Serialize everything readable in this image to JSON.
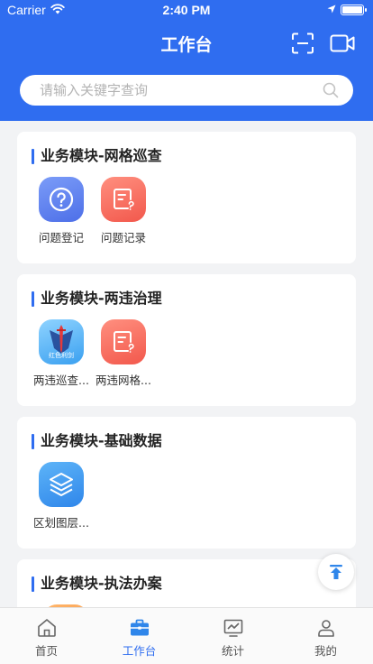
{
  "status_bar": {
    "carrier": "Carrier",
    "time": "2:40 PM"
  },
  "header": {
    "title": "工作台"
  },
  "search": {
    "placeholder": "请输入关键字查询"
  },
  "cards": [
    {
      "title": "业务模块-网格巡查",
      "apps": [
        {
          "label": "问题登记",
          "icon": "question-icon"
        },
        {
          "label": "问题记录",
          "icon": "record-icon"
        }
      ]
    },
    {
      "title": "业务模块-两违治理",
      "apps": [
        {
          "label": "两违巡查...",
          "icon": "sword-logo-icon",
          "logo_text": "红色利剑"
        },
        {
          "label": "两违网格...",
          "icon": "record-icon"
        }
      ]
    },
    {
      "title": "业务模块-基础数据",
      "apps": [
        {
          "label": "区划图层...",
          "icon": "layers-icon"
        }
      ]
    },
    {
      "title": "业务模块-执法办案",
      "apps": []
    }
  ],
  "tabbar": {
    "items": [
      {
        "label": "首页",
        "icon": "home-icon",
        "active": false
      },
      {
        "label": "工作台",
        "icon": "briefcase-icon",
        "active": true
      },
      {
        "label": "统计",
        "icon": "chart-icon",
        "active": false
      },
      {
        "label": "我的",
        "icon": "user-icon",
        "active": false
      }
    ]
  },
  "colors": {
    "primary": "#2f6df0",
    "background": "#f2f3f5",
    "tab_inactive": "#555555"
  }
}
